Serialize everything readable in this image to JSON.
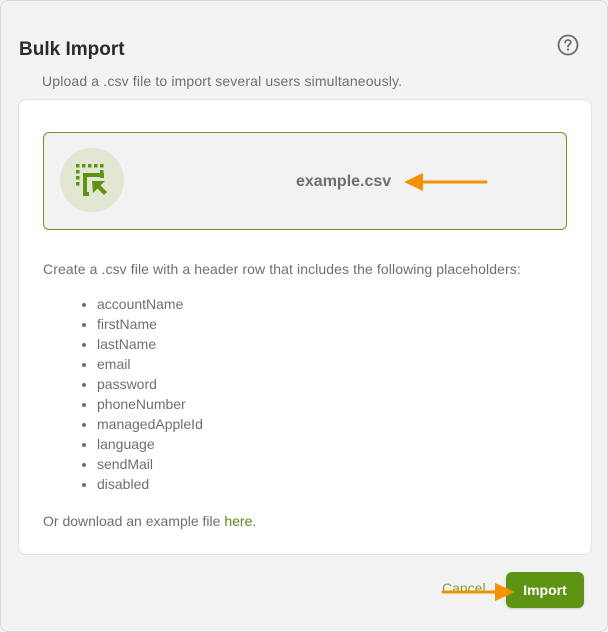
{
  "dialog": {
    "title": "Bulk Import",
    "subtitle": "Upload a .csv file to import several users simultaneously.",
    "help_icon": "help-circle-icon"
  },
  "dropzone": {
    "file_icon": "file-select-icon",
    "file_name": "example.csv"
  },
  "instructions": {
    "text": "Create a .csv file with a header row that includes the following placeholders:",
    "placeholders": [
      "accountName",
      "firstName",
      "lastName",
      "email",
      "password",
      "phoneNumber",
      "managedAppleId",
      "language",
      "sendMail",
      "disabled"
    ],
    "download_prefix": "Or download an example file ",
    "download_link": "here",
    "download_suffix": "."
  },
  "footer": {
    "cancel_label": "Cancel",
    "import_label": "Import"
  },
  "colors": {
    "accent": "#5f9313",
    "annotation_arrow": "#f39200"
  }
}
